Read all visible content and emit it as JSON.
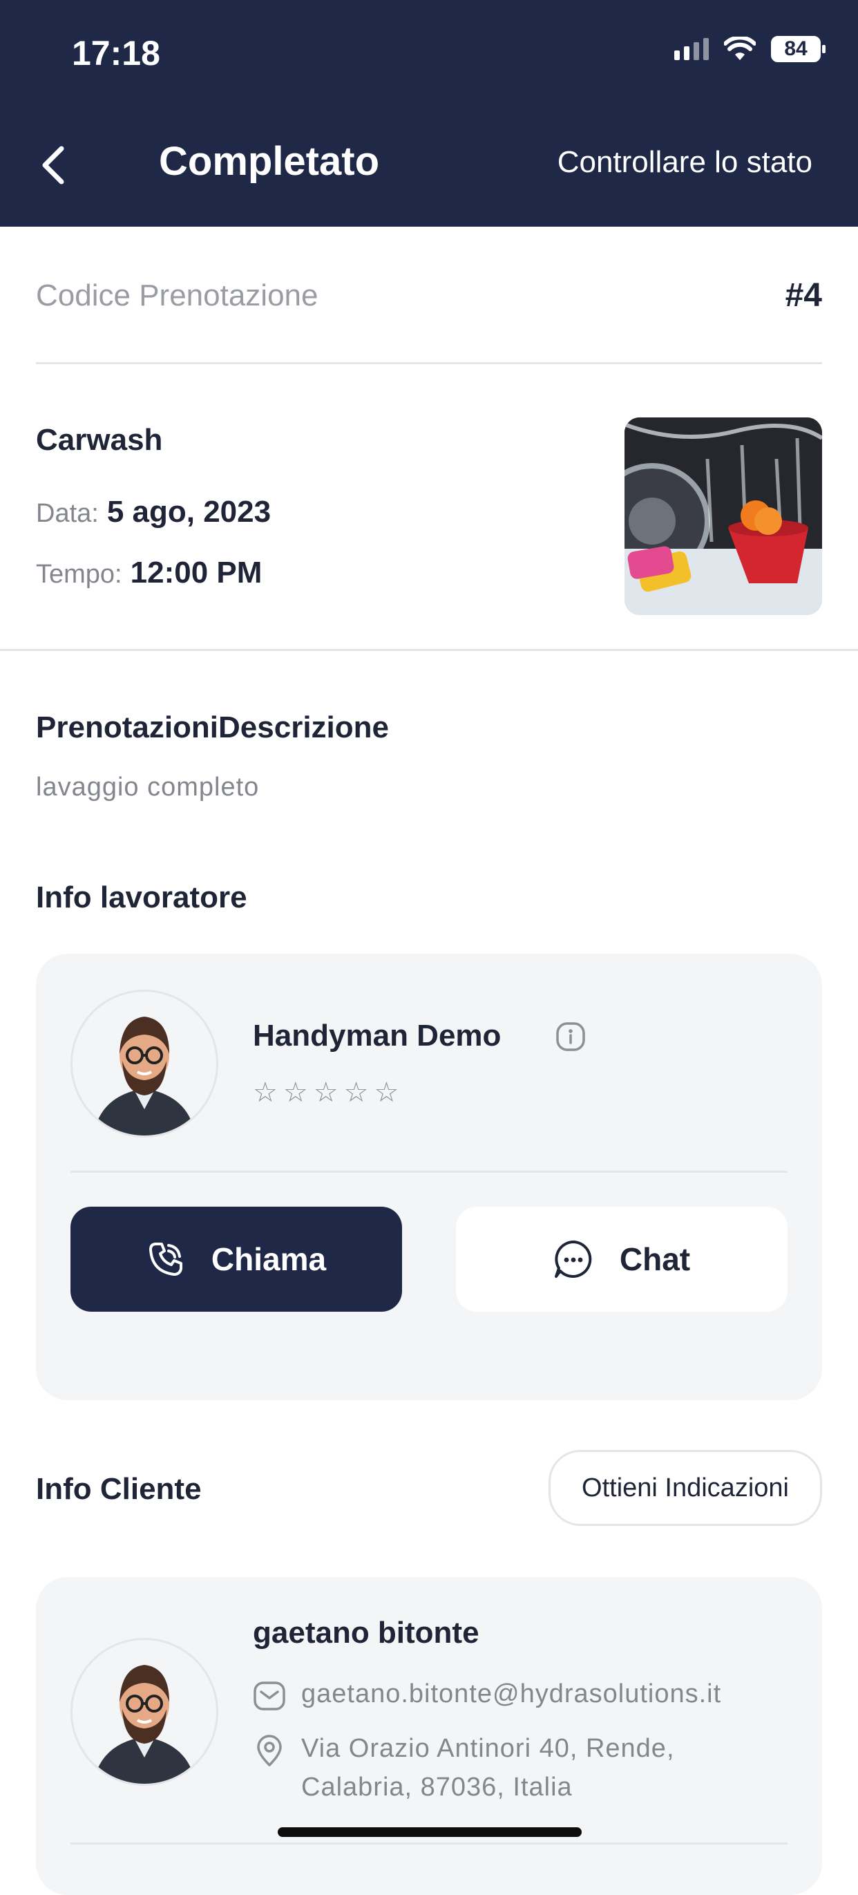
{
  "status_bar": {
    "time": "17:18",
    "battery": "84"
  },
  "header": {
    "title": "Completato",
    "action_label": "Controllare lo stato"
  },
  "booking": {
    "code_label": "Codice Prenotazione",
    "code_value": "#4",
    "service_name": "Carwash",
    "date_label": "Data:",
    "date_value": "5 ago, 2023",
    "time_label": "Tempo:",
    "time_value": "12:00 PM",
    "description_title": "PrenotazioniDescrizione",
    "description_text": "lavaggio completo"
  },
  "worker": {
    "section_title": "Info lavoratore",
    "name": "Handyman Demo",
    "rating": 0,
    "call_label": "Chiama",
    "chat_label": "Chat"
  },
  "client": {
    "section_title": "Info Cliente",
    "directions_label": "Ottieni Indicazioni",
    "name": "gaetano bitonte",
    "email": "gaetano.bitonte@hydrasolutions.it",
    "address_line1": "Via Orazio Antinori 40, Rende,",
    "address_line2": "Calabria, 87036, Italia"
  },
  "colors": {
    "primary": "#1f2846",
    "card_bg": "#f4f5f7",
    "muted_text": "#84868d"
  }
}
